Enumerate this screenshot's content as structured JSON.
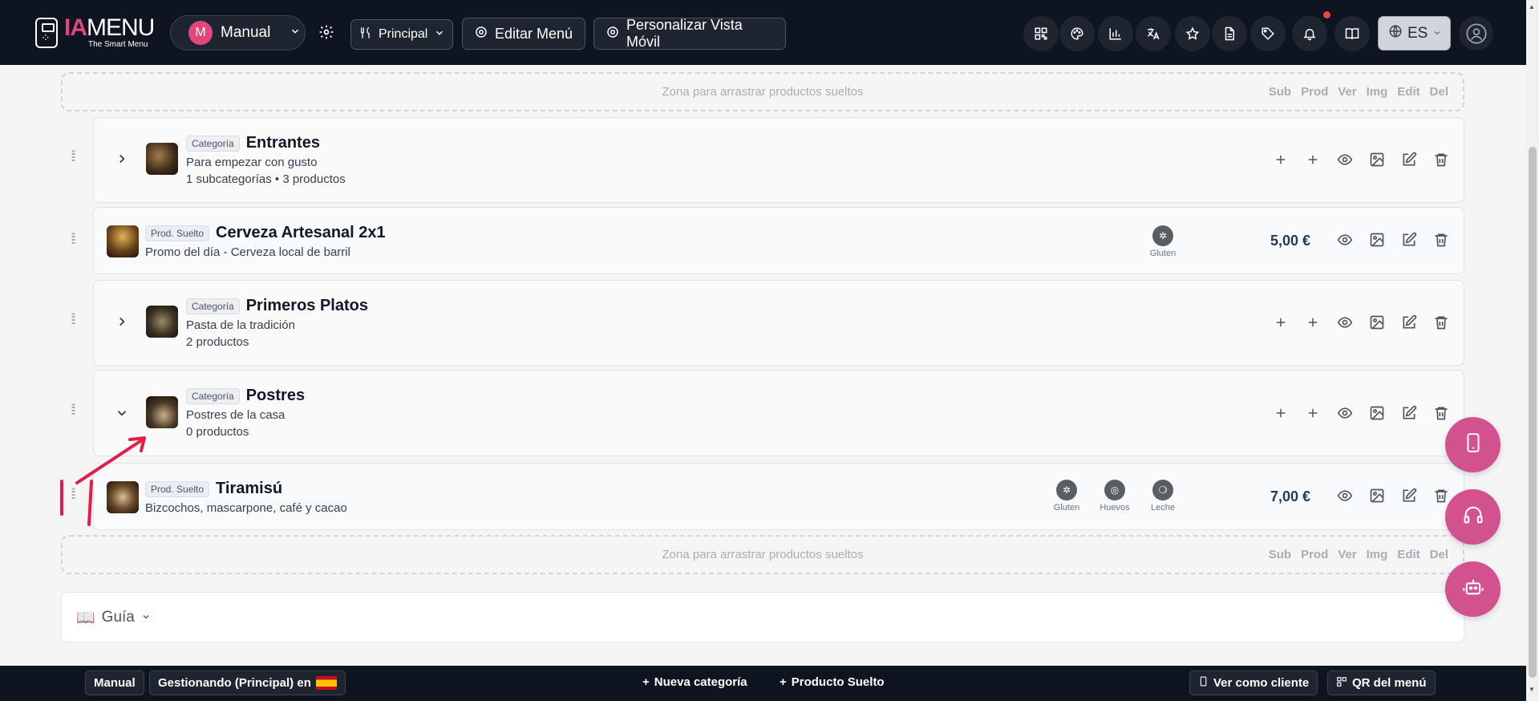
{
  "header": {
    "logo_ia": "IA",
    "logo_menu": "MENU",
    "logo_tagline": "The Smart Menu",
    "menu_select": {
      "avatar_letter": "M",
      "label": "Manual"
    },
    "principal_label": "Principal",
    "editar_menu_label": "Editar Menú",
    "personalizar_label": "Personalizar Vista Móvil",
    "language": "ES"
  },
  "drop_zone": {
    "label": "Zona para arrastrar productos sueltos",
    "columns": [
      "Sub",
      "Prod",
      "Ver",
      "Img",
      "Edit",
      "Del"
    ]
  },
  "rows": [
    {
      "kind": "category",
      "badge": "Categoría",
      "title": "Entrantes",
      "description": "Para empezar con gusto",
      "meta": "1 subcategorías • 3 productos",
      "expanded": false
    },
    {
      "kind": "product",
      "badge": "Prod. Suelto",
      "title": "Cerveza Artesanal 2x1",
      "description": "Promo del día - Cerveza local de barril",
      "price": "5,00 €",
      "allergens": [
        "Gluten"
      ]
    },
    {
      "kind": "category",
      "badge": "Categoría",
      "title": "Primeros Platos",
      "description": "Pasta de la tradición",
      "meta": "2 productos",
      "expanded": false
    },
    {
      "kind": "category",
      "badge": "Categoría",
      "title": "Postres",
      "description": "Postres de la casa",
      "meta": "0 productos",
      "expanded": true
    },
    {
      "kind": "product",
      "badge": "Prod. Suelto",
      "title": "Tiramisú",
      "description": "Bizcochos, mascarpone, café y cacao",
      "price": "7,00 €",
      "allergens": [
        "Gluten",
        "Huevos",
        "Leche"
      ]
    }
  ],
  "guide": {
    "label": "Guía"
  },
  "bottom_bar": {
    "manual_label": "Manual",
    "gestionando_label": "Gestionando (Principal) en",
    "nueva_categoria": "Nueva categoría",
    "producto_suelto": "Producto Suelto",
    "ver_como_cliente": "Ver como cliente",
    "qr_menu": "QR del menú"
  },
  "colors": {
    "brand_pink": "#e2467a",
    "fab_pink": "#d1528f",
    "topbar_bg": "#0f1520",
    "price_color": "#1e3a5f",
    "annotation_red": "#e11d48"
  },
  "icons": [
    "qr-icon",
    "palette-icon",
    "chart-icon",
    "translate-icon",
    "star-icon",
    "document-icon",
    "tag-icon",
    "bell-icon",
    "book-icon",
    "globe-icon",
    "user-icon",
    "mobile-icon",
    "headset-icon",
    "robot-icon"
  ]
}
